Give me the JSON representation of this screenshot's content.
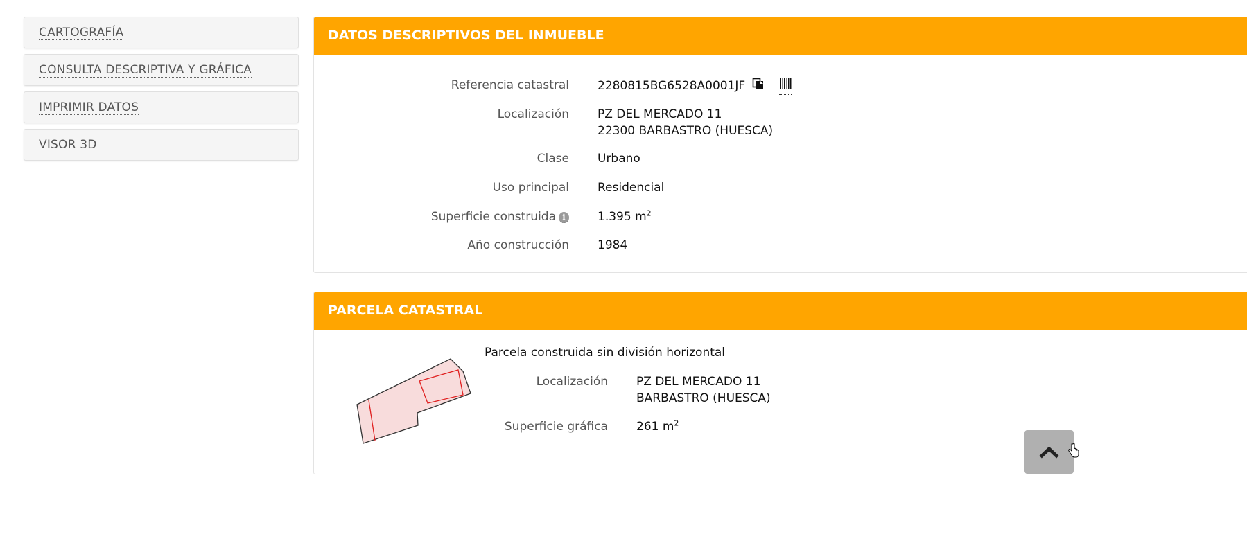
{
  "sidebar": {
    "items": [
      {
        "label": "CARTOGRAFÍA"
      },
      {
        "label": "CONSULTA DESCRIPTIVA Y GRÁFICA"
      },
      {
        "label": "IMPRIMIR DATOS"
      },
      {
        "label": "VISOR 3D"
      }
    ]
  },
  "inmueble": {
    "title": "DATOS DESCRIPTIVOS DEL INMUEBLE",
    "ref_label": "Referencia catastral",
    "ref_value": "2280815BG6528A0001JF",
    "loc_label": "Localización",
    "loc_line1": "PZ DEL MERCADO 11",
    "loc_line2": "22300 BARBASTRO (HUESCA)",
    "clase_label": "Clase",
    "clase_value": "Urbano",
    "uso_label": "Uso principal",
    "uso_value": "Residencial",
    "sup_label": "Superficie construida",
    "sup_value": "1.395 m",
    "sup_unit_exp": "2",
    "anio_label": "Año construcción",
    "anio_value": "1984"
  },
  "parcela": {
    "title": "PARCELA CATASTRAL",
    "subtitle": "Parcela construida sin división horizontal",
    "loc_label": "Localización",
    "loc_line1": "PZ DEL MERCADO 11",
    "loc_line2": "BARBASTRO (HUESCA)",
    "sup_label": "Superficie gráfica",
    "sup_value": "261 m",
    "sup_unit_exp": "2"
  },
  "colors": {
    "accent": "#ffa500",
    "parcel_fill": "#f8dcdc",
    "parcel_line": "#e02020"
  },
  "icons": {
    "copy": "copy-icon",
    "barcode": "barcode-icon",
    "info": "info-icon",
    "scroll_top": "chevron-up-icon"
  }
}
